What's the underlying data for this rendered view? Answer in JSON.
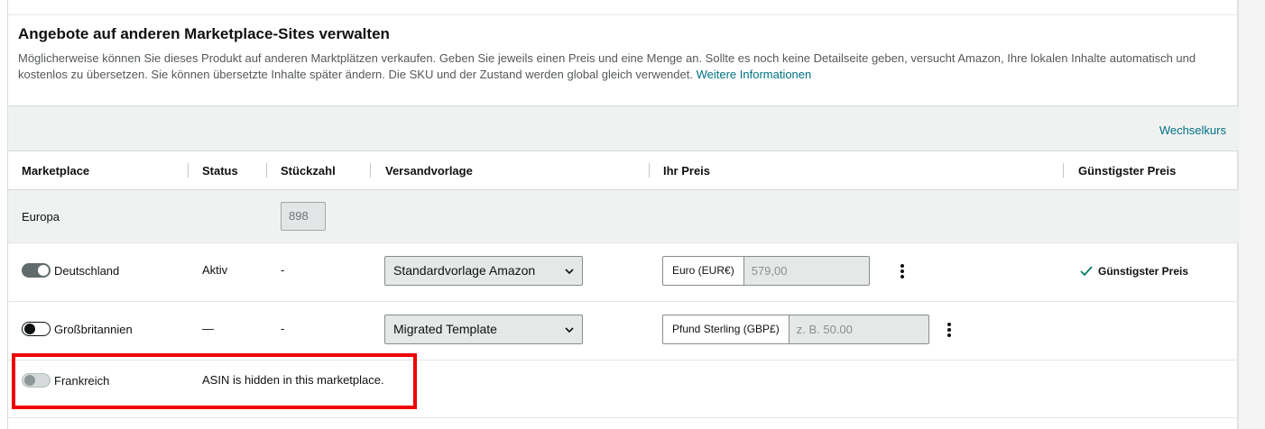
{
  "section": {
    "title": "Angebote auf anderen Marketplace-Sites verwalten",
    "description": "Möglicherweise können Sie dieses Produkt auf anderen Marktplätzen verkaufen. Geben Sie jeweils einen Preis und eine Menge an. Sollte es noch keine Detailseite geben, versucht Amazon, Ihre lokalen Inhalte automatisch und kostenlos zu übersetzen. Sie können übersetzte Inhalte später ändern. Die SKU und der Zustand werden global gleich verwendet.",
    "more_info_link": "Weitere Informationen"
  },
  "toolbar": {
    "exchange_rate_link": "Wechselkurs"
  },
  "columns": {
    "marketplace": "Marketplace",
    "status": "Status",
    "quantity": "Stückzahl",
    "shipping_template": "Versandvorlage",
    "your_price": "Ihr Preis",
    "lowest_price": "Günstigster Preis"
  },
  "group": {
    "name": "Europa",
    "quantity": "898"
  },
  "rows": [
    {
      "marketplace": "Deutschland",
      "toggle": "on",
      "status": "Aktiv",
      "quantity": "-",
      "shipping_template": "Standardvorlage Amazon",
      "currency": "Euro (EUR€)",
      "price": "579,00",
      "lowest_price": "Günstigster Preis"
    },
    {
      "marketplace": "Großbritannien",
      "toggle": "off",
      "status": "—",
      "quantity": "-",
      "shipping_template": "Migrated Template",
      "currency": "Pfund Sterling (GBP£)",
      "price_placeholder": "z. B. 50.00"
    },
    {
      "marketplace": "Frankreich",
      "toggle": "disabled",
      "status": "ASIN is hidden in this marketplace."
    }
  ],
  "colors": {
    "link": "#007185",
    "highlight": "#ee0000",
    "check": "#067d62",
    "header_bg": "#f0f2f2"
  },
  "icons": [
    "chevron-down-icon",
    "more-options-icon",
    "checkmark-icon"
  ]
}
